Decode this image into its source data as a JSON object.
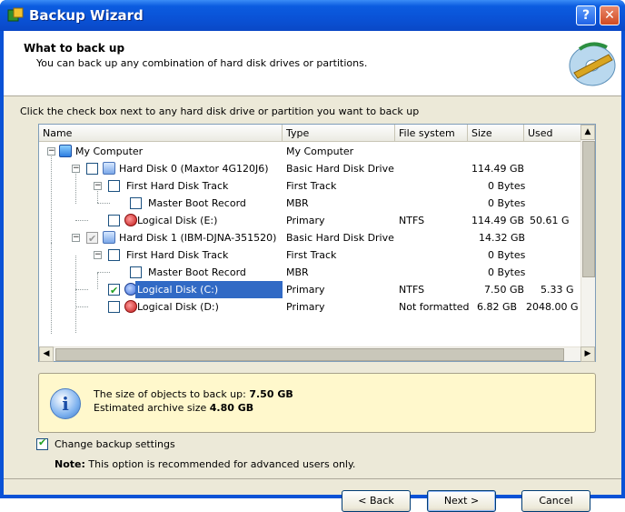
{
  "window": {
    "title": "Backup Wizard",
    "help_label": "?",
    "close_label": "✕"
  },
  "header": {
    "title": "What to back up",
    "subtitle": "You can back up any combination of hard disk drives or partitions."
  },
  "instruction": "Click the check box next to any hard disk drive or partition you want to back up",
  "grid": {
    "columns": [
      "Name",
      "Type",
      "File system",
      "Size",
      "Used"
    ],
    "rows": [
      {
        "name": "My Computer",
        "type": "My Computer",
        "fs": "",
        "size": "",
        "used": ""
      },
      {
        "name": "Hard Disk 0 (Maxtor 4G120J6)",
        "type": "Basic Hard Disk Drive",
        "fs": "",
        "size": "114.49 GB",
        "used": ""
      },
      {
        "name": "First Hard Disk Track",
        "type": "First Track",
        "fs": "",
        "size": "0 Bytes",
        "used": ""
      },
      {
        "name": "Master Boot Record",
        "type": "MBR",
        "fs": "",
        "size": "0 Bytes",
        "used": ""
      },
      {
        "name": "Logical Disk (E:)",
        "type": "Primary",
        "fs": "NTFS",
        "size": "114.49 GB",
        "used": "50.61 G"
      },
      {
        "name": "Hard Disk 1 (IBM-DJNA-351520)",
        "type": "Basic Hard Disk Drive",
        "fs": "",
        "size": "14.32 GB",
        "used": ""
      },
      {
        "name": "First Hard Disk Track",
        "type": "First Track",
        "fs": "",
        "size": "0 Bytes",
        "used": ""
      },
      {
        "name": "Master Boot Record",
        "type": "MBR",
        "fs": "",
        "size": "0 Bytes",
        "used": ""
      },
      {
        "name": "Logical Disk (C:)",
        "type": "Primary",
        "fs": "NTFS",
        "size": "7.50 GB",
        "used": "5.33 G"
      },
      {
        "name": "Logical Disk (D:)",
        "type": "Primary",
        "fs": "Not formatted",
        "size": "6.82 GB",
        "used": "2048.00 G"
      }
    ]
  },
  "info": {
    "line1_prefix": "The size of objects to back up: ",
    "line1_value": "7.50 GB",
    "line2_prefix": "Estimated archive size ",
    "line2_value": "4.80 GB"
  },
  "options": {
    "change_settings_label": "Change backup settings",
    "note_label": "Note:",
    "note_text": " This option is recommended for advanced users only."
  },
  "buttons": {
    "back": "< Back",
    "next": "Next >",
    "cancel": "Cancel"
  }
}
